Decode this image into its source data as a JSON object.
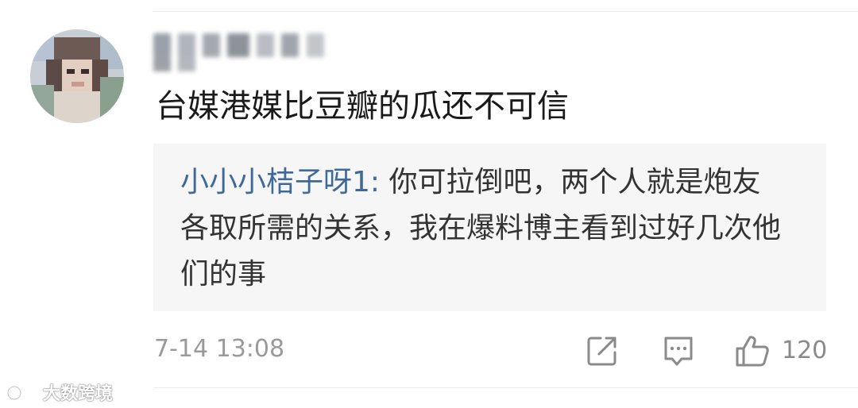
{
  "comment": {
    "text": "台媒港媒比豆瓣的瓜还不可信",
    "timestamp": "7-14 13:08",
    "like_count": "120"
  },
  "reply": {
    "author": "小小小桔子呀1",
    "separator": ": ",
    "text": "你可拉倒吧，两个人就是炮友各取所需的关系，我在爆料博主看到过好几次他们的事"
  },
  "actions": {
    "share_icon": "share-icon",
    "reply_icon": "comment-icon",
    "like_icon": "thumbs-up-icon"
  },
  "watermark": {
    "text": "大数跨境"
  },
  "colors": {
    "reply_author": "#3f6999",
    "reply_background": "#f6f6f6",
    "muted_text": "#9a9a9a",
    "icon": "#8a8a8a"
  }
}
